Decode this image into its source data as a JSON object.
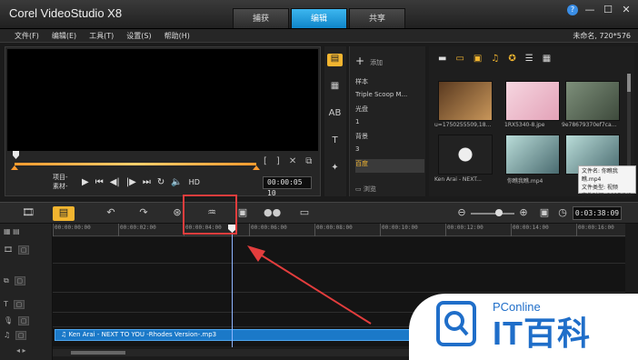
{
  "app": {
    "title": "Corel VideoStudio X8"
  },
  "tabs": [
    {
      "label": "捕获"
    },
    {
      "label": "编辑"
    },
    {
      "label": "共享"
    }
  ],
  "window_controls": {
    "help": "?",
    "minimize": "—",
    "maximize": "☐",
    "close": "✕"
  },
  "menu": {
    "items": [
      {
        "label": "文件(F)"
      },
      {
        "label": "编辑(E)"
      },
      {
        "label": "工具(T)"
      },
      {
        "label": "设置(S)"
      },
      {
        "label": "帮助(H)"
      }
    ],
    "project_info": "未命名, 720*576"
  },
  "preview": {
    "mode_project": "项目-",
    "mode_clip": "素材-",
    "timecode": "00:00:05 10",
    "hd_label": "HD"
  },
  "library": {
    "add_label": "添加",
    "browse_label": "浏览",
    "items": [
      {
        "label": "样本"
      },
      {
        "label": "Triple Scoop M..."
      },
      {
        "label": "光盘"
      },
      {
        "label": "1"
      },
      {
        "label": "背景"
      },
      {
        "label": "3"
      },
      {
        "label": "百度"
      }
    ],
    "selected_index": 6,
    "thumbnails": [
      {
        "caption": "u=1750255509,18...",
        "color": "#9a6a3a"
      },
      {
        "caption": "1RX5340-8.jpe",
        "color": "#e9b7c6"
      },
      {
        "caption": "9e78679370ef7ca...",
        "color": "#6d7f6a"
      },
      {
        "caption": "Ken Arai - NEXT...",
        "color": "#222222"
      },
      {
        "caption": "你瞧我瞧.mp4",
        "color": "#9fc7c4"
      },
      {
        "caption": "你瞧我瞧.mp4",
        "color": "#9fc7c4"
      }
    ],
    "tooltip": {
      "line1": "文件名: 你瞧我瞧.mp4",
      "line2": "文件类型: 视频",
      "line3": "文件时间: 2017/2/8 1"
    }
  },
  "timeline": {
    "timecode": "0:03:38:09",
    "ruler_labels": [
      "00:00:00:00",
      "00:00:02:00",
      "00:00:04:00",
      "00:00:06:00",
      "00:00:08:00",
      "00:00:10:00",
      "00:00:12:00",
      "00:00:14:00",
      "00:00:16:00"
    ],
    "audio_clip_label": "Ken Arai - NEXT TO YOU -Rhodes Version-.mp3"
  },
  "watermark": {
    "brand_small": "PConline",
    "brand_big": "IT百科"
  },
  "colors": {
    "accent_blue": "#1b8fd6",
    "accent_yellow": "#f2b530",
    "highlight_red": "#e33d3d",
    "clip_blue": "#1b79c8"
  },
  "icons": [
    "film-icon",
    "storyboard-icon",
    "undo-icon",
    "redo-icon",
    "record-icon",
    "sound-mixer-icon",
    "auto-music-icon",
    "motion-icon",
    "subtitle-icon",
    "zoom-out-icon",
    "zoom-in-icon",
    "fit-icon",
    "play-icon",
    "home-icon",
    "prev-frame-icon",
    "next-frame-icon",
    "end-icon",
    "repeat-icon",
    "volume-icon"
  ]
}
